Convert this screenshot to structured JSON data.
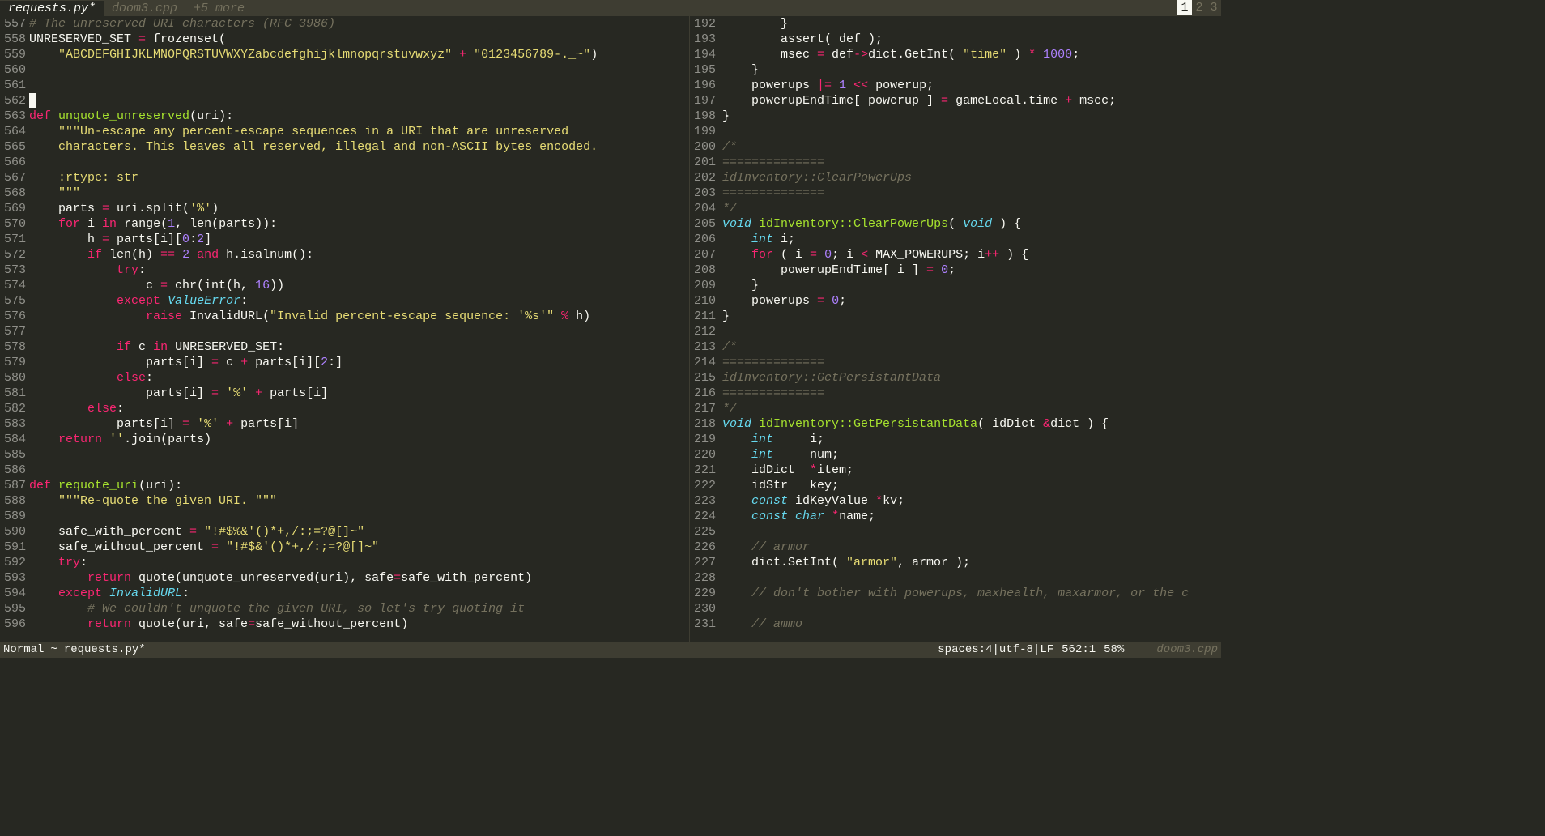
{
  "tabs": {
    "active": "requests.py*",
    "other": "doom3.cpp",
    "more": "+5 more"
  },
  "pager": {
    "p1": "1",
    "p2": "2",
    "p3": "3"
  },
  "status": {
    "mode": "Normal",
    "sep": "~",
    "file": "requests.py*",
    "indent": "spaces:4",
    "encoding": "utf-8",
    "eol": "LF",
    "pos": "562:1",
    "percent": "58%",
    "rightfile": "doom3.cpp"
  },
  "left": {
    "start": 557,
    "lines": [
      {
        "n": 557,
        "h": "<span class='c-comment'># The unreserved URI characters (RFC 3986)</span>"
      },
      {
        "n": 558,
        "h": "UNRESERVED_SET <span class='c-op'>=</span> frozenset("
      },
      {
        "n": 559,
        "h": "    <span class='c-string'>\"ABCDEFGHIJKLMNOPQRSTUVWXYZabcdefghijklmnopqrstuvwxyz\"</span> <span class='c-op'>+</span> <span class='c-string'>\"0123456789-._~\"</span>)"
      },
      {
        "n": 560,
        "h": ""
      },
      {
        "n": 561,
        "h": ""
      },
      {
        "n": 562,
        "h": "<span class='cursor'> </span>"
      },
      {
        "n": 563,
        "h": "<span class='c-keyword'>def</span> <span class='c-func'>unquote_unreserved</span>(uri):"
      },
      {
        "n": 564,
        "h": "    <span class='c-string'>\"\"\"Un-escape any percent-escape sequences in a URI that are unreserved</span>"
      },
      {
        "n": 565,
        "h": "<span class='c-string'>    characters. This leaves all reserved, illegal and non-ASCII bytes encoded.</span>"
      },
      {
        "n": 566,
        "h": ""
      },
      {
        "n": 567,
        "h": "<span class='c-string'>    :rtype: str</span>"
      },
      {
        "n": 568,
        "h": "<span class='c-string'>    \"\"\"</span>"
      },
      {
        "n": 569,
        "h": "    parts <span class='c-op'>=</span> uri.split(<span class='c-string'>'%'</span>)"
      },
      {
        "n": 570,
        "h": "    <span class='c-keyword'>for</span> i <span class='c-keyword'>in</span> range(<span class='c-number'>1</span>, len(parts)):"
      },
      {
        "n": 571,
        "h": "        h <span class='c-op'>=</span> parts[i][<span class='c-number'>0</span>:<span class='c-number'>2</span>]"
      },
      {
        "n": 572,
        "h": "        <span class='c-keyword'>if</span> len(h) <span class='c-op'>==</span> <span class='c-number'>2</span> <span class='c-keyword'>and</span> h.isalnum():"
      },
      {
        "n": 573,
        "h": "            <span class='c-keyword'>try</span>:"
      },
      {
        "n": 574,
        "h": "                c <span class='c-op'>=</span> chr(int(h, <span class='c-number'>16</span>))"
      },
      {
        "n": 575,
        "h": "            <span class='c-keyword'>except</span> <span class='c-type'>ValueError</span>:"
      },
      {
        "n": 576,
        "h": "                <span class='c-keyword'>raise</span> InvalidURL(<span class='c-string'>\"Invalid percent-escape sequence: '%s'\"</span> <span class='c-op'>%</span> h)"
      },
      {
        "n": 577,
        "h": ""
      },
      {
        "n": 578,
        "h": "            <span class='c-keyword'>if</span> c <span class='c-keyword'>in</span> UNRESERVED_SET:"
      },
      {
        "n": 579,
        "h": "                parts[i] <span class='c-op'>=</span> c <span class='c-op'>+</span> parts[i][<span class='c-number'>2</span>:]"
      },
      {
        "n": 580,
        "h": "            <span class='c-keyword'>else</span>:"
      },
      {
        "n": 581,
        "h": "                parts[i] <span class='c-op'>=</span> <span class='c-string'>'%'</span> <span class='c-op'>+</span> parts[i]"
      },
      {
        "n": 582,
        "h": "        <span class='c-keyword'>else</span>:"
      },
      {
        "n": 583,
        "h": "            parts[i] <span class='c-op'>=</span> <span class='c-string'>'%'</span> <span class='c-op'>+</span> parts[i]"
      },
      {
        "n": 584,
        "h": "    <span class='c-keyword'>return</span> <span class='c-string'>''</span>.join(parts)"
      },
      {
        "n": 585,
        "h": ""
      },
      {
        "n": 586,
        "h": ""
      },
      {
        "n": 587,
        "h": "<span class='c-keyword'>def</span> <span class='c-func'>requote_uri</span>(uri):"
      },
      {
        "n": 588,
        "h": "    <span class='c-string'>\"\"\"Re-quote the given URI. \"\"\"</span>"
      },
      {
        "n": 589,
        "h": ""
      },
      {
        "n": 590,
        "h": "    safe_with_percent <span class='c-op'>=</span> <span class='c-string'>\"!#$%&'()*+,/:;=?@[]~\"</span>"
      },
      {
        "n": 591,
        "h": "    safe_without_percent <span class='c-op'>=</span> <span class='c-string'>\"!#$&'()*+,/:;=?@[]~\"</span>"
      },
      {
        "n": 592,
        "h": "    <span class='c-keyword'>try</span>:"
      },
      {
        "n": 593,
        "h": "        <span class='c-keyword'>return</span> quote(unquote_unreserved(uri), safe<span class='c-op'>=</span>safe_with_percent)"
      },
      {
        "n": 594,
        "h": "    <span class='c-keyword'>except</span> <span class='c-type'>InvalidURL</span>:"
      },
      {
        "n": 595,
        "h": "        <span class='c-comment'># We couldn't unquote the given URI, so let's try quoting it</span>"
      },
      {
        "n": 596,
        "h": "        <span class='c-keyword'>return</span> quote(uri, safe<span class='c-op'>=</span>safe_without_percent)"
      }
    ]
  },
  "right": {
    "lines": [
      {
        "n": 192,
        "h": "        }"
      },
      {
        "n": 193,
        "h": "        assert( def );"
      },
      {
        "n": 194,
        "h": "        msec <span class='c-op'>=</span> def<span class='c-op'>-&gt;</span>dict.GetInt( <span class='c-string'>\"time\"</span> ) <span class='c-op'>*</span> <span class='c-number'>1000</span>;"
      },
      {
        "n": 195,
        "h": "    }"
      },
      {
        "n": 196,
        "h": "    powerups <span class='c-op'>|=</span> <span class='c-number'>1</span> <span class='c-op'>&lt;&lt;</span> powerup;"
      },
      {
        "n": 197,
        "h": "    powerupEndTime[ powerup ] <span class='c-op'>=</span> gameLocal.time <span class='c-op'>+</span> msec;"
      },
      {
        "n": 198,
        "h": "}"
      },
      {
        "n": 199,
        "h": ""
      },
      {
        "n": 200,
        "h": "<span class='c-comment'>/*</span>"
      },
      {
        "n": 201,
        "h": "<span class='c-comment'>==============</span>"
      },
      {
        "n": 202,
        "h": "<span class='c-comment'>idInventory::ClearPowerUps</span>"
      },
      {
        "n": 203,
        "h": "<span class='c-comment'>==============</span>"
      },
      {
        "n": 204,
        "h": "<span class='c-comment'>*/</span>"
      },
      {
        "n": 205,
        "h": "<span class='c-type'>void</span> <span class='c-func'>idInventory::ClearPowerUps</span>( <span class='c-type'>void</span> ) {"
      },
      {
        "n": 206,
        "h": "    <span class='c-type'>int</span> i;"
      },
      {
        "n": 207,
        "h": "    <span class='c-keyword'>for</span> ( i <span class='c-op'>=</span> <span class='c-number'>0</span>; i <span class='c-op'>&lt;</span> MAX_POWERUPS; i<span class='c-op'>++</span> ) {"
      },
      {
        "n": 208,
        "h": "        powerupEndTime[ i ] <span class='c-op'>=</span> <span class='c-number'>0</span>;"
      },
      {
        "n": 209,
        "h": "    }"
      },
      {
        "n": 210,
        "h": "    powerups <span class='c-op'>=</span> <span class='c-number'>0</span>;"
      },
      {
        "n": 211,
        "h": "}"
      },
      {
        "n": 212,
        "h": ""
      },
      {
        "n": 213,
        "h": "<span class='c-comment'>/*</span>"
      },
      {
        "n": 214,
        "h": "<span class='c-comment'>==============</span>"
      },
      {
        "n": 215,
        "h": "<span class='c-comment'>idInventory::GetPersistantData</span>"
      },
      {
        "n": 216,
        "h": "<span class='c-comment'>==============</span>"
      },
      {
        "n": 217,
        "h": "<span class='c-comment'>*/</span>"
      },
      {
        "n": 218,
        "h": "<span class='c-type'>void</span> <span class='c-func'>idInventory::GetPersistantData</span>( idDict <span class='c-op'>&amp;</span>dict ) {"
      },
      {
        "n": 219,
        "h": "    <span class='c-type'>int</span>     i;"
      },
      {
        "n": 220,
        "h": "    <span class='c-type'>int</span>     num;"
      },
      {
        "n": 221,
        "h": "    idDict  <span class='c-op'>*</span>item;"
      },
      {
        "n": 222,
        "h": "    idStr   key;"
      },
      {
        "n": 223,
        "h": "    <span class='c-type'>const</span> idKeyValue <span class='c-op'>*</span>kv;"
      },
      {
        "n": 224,
        "h": "    <span class='c-type'>const</span> <span class='c-type'>char</span> <span class='c-op'>*</span>name;"
      },
      {
        "n": 225,
        "h": ""
      },
      {
        "n": 226,
        "h": "    <span class='c-comment'>// armor</span>"
      },
      {
        "n": 227,
        "h": "    dict.SetInt( <span class='c-string'>\"armor\"</span>, armor );"
      },
      {
        "n": 228,
        "h": ""
      },
      {
        "n": 229,
        "h": "    <span class='c-comment'>// don't bother with powerups, maxhealth, maxarmor, or the c</span>"
      },
      {
        "n": 230,
        "h": ""
      },
      {
        "n": 231,
        "h": "    <span class='c-comment'>// ammo</span>"
      }
    ]
  }
}
